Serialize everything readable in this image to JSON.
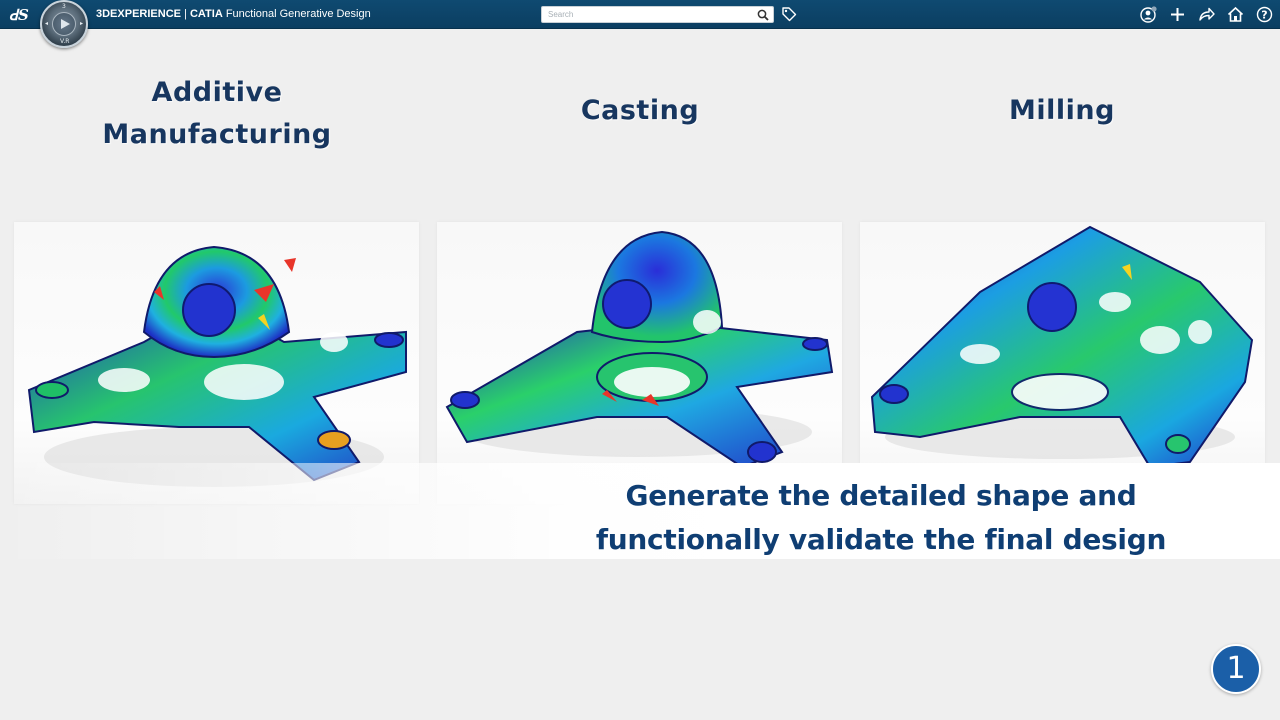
{
  "topbar": {
    "brand_bold": "3DEXPERIENCE",
    "separator": " | ",
    "app_bold": "CATIA",
    "app_name": " Functional Generative Design",
    "search_placeholder": "Search",
    "icons": [
      "ds-logo-icon",
      "compass-icon",
      "search-icon",
      "tag-icon",
      "user-icon",
      "add-icon",
      "share-icon",
      "home-icon",
      "help-icon"
    ],
    "color": "#0f4a71"
  },
  "ds_logo": "𝔇𝔖",
  "headings": {
    "additive_line1": "Additive",
    "additive_line2": "Manufacturing",
    "casting": "Casting",
    "milling": "Milling"
  },
  "caption": {
    "line1": "Generate the detailed shape and",
    "line2": "functionally validate the final design"
  },
  "step_badge": "1",
  "colors": {
    "heading": "#17365f",
    "caption": "#0f3e73",
    "badge": "#1b5fa8"
  }
}
